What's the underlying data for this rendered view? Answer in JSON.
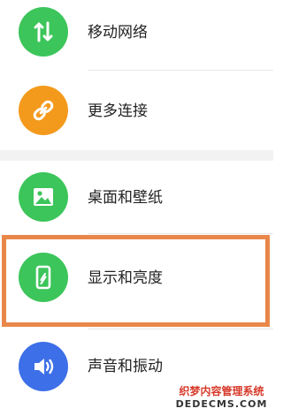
{
  "settings": {
    "items": [
      {
        "label": "移动网络",
        "icon": "arrows-up-down-icon",
        "color": "#3cc55a"
      },
      {
        "label": "更多连接",
        "icon": "link-icon",
        "color": "#f39a1d"
      },
      {
        "label": "桌面和壁纸",
        "icon": "image-icon",
        "color": "#3cc55a"
      },
      {
        "label": "显示和亮度",
        "icon": "phone-brightness-icon",
        "color": "#3cc55a"
      },
      {
        "label": "声音和振动",
        "icon": "speaker-icon",
        "color": "#3d6fe8"
      }
    ]
  },
  "watermark": {
    "line1": "织梦内容管理系统",
    "line2": "DEDECMS.COM"
  },
  "colors": {
    "highlight_border": "#e9874a",
    "section_gap": "#f2f2f2"
  }
}
